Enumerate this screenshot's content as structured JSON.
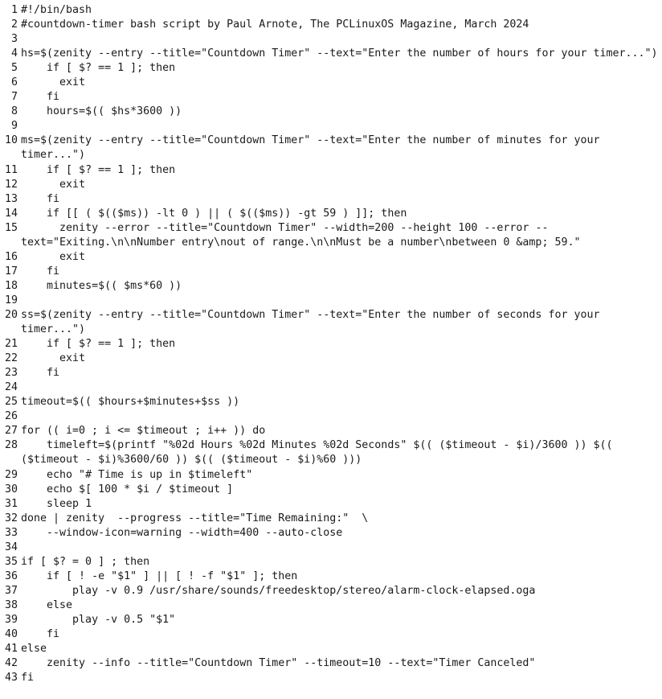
{
  "document": {
    "kind": "source-code-listing",
    "language": "bash",
    "background_color": "#ffffff",
    "text_color": "#1a1a1a",
    "line_number_gutter": true,
    "first_line_number": 1,
    "last_line_number": 43,
    "wrap_mode": "soft-wrap-with-hanging-indent"
  },
  "lines": [
    {
      "number": "1",
      "text": "#!/bin/bash"
    },
    {
      "number": "2",
      "text": "#countdown-timer bash script by Paul Arnote, The PCLinuxOS Magazine, March 2024"
    },
    {
      "number": "3",
      "text": ""
    },
    {
      "number": "4",
      "text": "hs=$(zenity --entry --title=\"Countdown Timer\" --text=\"Enter the number of hours for your timer...\")"
    },
    {
      "number": "5",
      "text": "    if [ $? == 1 ]; then"
    },
    {
      "number": "6",
      "text": "      exit"
    },
    {
      "number": "7",
      "text": "    fi"
    },
    {
      "number": "8",
      "text": "    hours=$(( $hs*3600 ))"
    },
    {
      "number": "9",
      "text": ""
    },
    {
      "number": "10",
      "text": "ms=$(zenity --entry --title=\"Countdown Timer\" --text=\"Enter the number of minutes for your timer...\")"
    },
    {
      "number": "11",
      "text": "    if [ $? == 1 ]; then"
    },
    {
      "number": "12",
      "text": "      exit"
    },
    {
      "number": "13",
      "text": "    fi"
    },
    {
      "number": "14",
      "text": "    if [[ ( $(($ms)) -lt 0 ) || ( $(($ms)) -gt 59 ) ]]; then"
    },
    {
      "number": "15",
      "text": "      zenity --error --title=\"Countdown Timer\" --width=200 --height 100 --error --text=\"Exiting.\\n\\nNumber entry\\nout of range.\\n\\nMust be a number\\nbetween 0 &amp; 59.\""
    },
    {
      "number": "16",
      "text": "      exit"
    },
    {
      "number": "17",
      "text": "    fi"
    },
    {
      "number": "18",
      "text": "    minutes=$(( $ms*60 ))"
    },
    {
      "number": "19",
      "text": ""
    },
    {
      "number": "20",
      "text": "ss=$(zenity --entry --title=\"Countdown Timer\" --text=\"Enter the number of seconds for your timer...\")"
    },
    {
      "number": "21",
      "text": "    if [ $? == 1 ]; then"
    },
    {
      "number": "22",
      "text": "      exit"
    },
    {
      "number": "23",
      "text": "    fi"
    },
    {
      "number": "24",
      "text": ""
    },
    {
      "number": "25",
      "text": "timeout=$(( $hours+$minutes+$ss ))"
    },
    {
      "number": "26",
      "text": ""
    },
    {
      "number": "27",
      "text": "for (( i=0 ; i <= $timeout ; i++ )) do"
    },
    {
      "number": "28",
      "text": "    timeleft=$(printf \"%02d Hours %02d Minutes %02d Seconds\" $(( ($timeout - $i)/3600 )) $(( ($timeout - $i)%3600/60 )) $(( ($timeout - $i)%60 )))"
    },
    {
      "number": "29",
      "text": "    echo \"# Time is up in $timeleft\""
    },
    {
      "number": "30",
      "text": "    echo $[ 100 * $i / $timeout ]"
    },
    {
      "number": "31",
      "text": "    sleep 1"
    },
    {
      "number": "32",
      "text": "done | zenity  --progress --title=\"Time Remaining:\"  \\"
    },
    {
      "number": "33",
      "text": "    --window-icon=warning --width=400 --auto-close"
    },
    {
      "number": "34",
      "text": ""
    },
    {
      "number": "35",
      "text": "if [ $? = 0 ] ; then"
    },
    {
      "number": "36",
      "text": "    if [ ! -e \"$1\" ] || [ ! -f \"$1\" ]; then"
    },
    {
      "number": "37",
      "text": "        play -v 0.9 /usr/share/sounds/freedesktop/stereo/alarm-clock-elapsed.oga"
    },
    {
      "number": "38",
      "text": "    else"
    },
    {
      "number": "39",
      "text": "        play -v 0.5 \"$1\""
    },
    {
      "number": "40",
      "text": "    fi"
    },
    {
      "number": "41",
      "text": "else"
    },
    {
      "number": "42",
      "text": "    zenity --info --title=\"Countdown Timer\" --timeout=10 --text=\"Timer Canceled\""
    },
    {
      "number": "43",
      "text": "fi"
    }
  ]
}
